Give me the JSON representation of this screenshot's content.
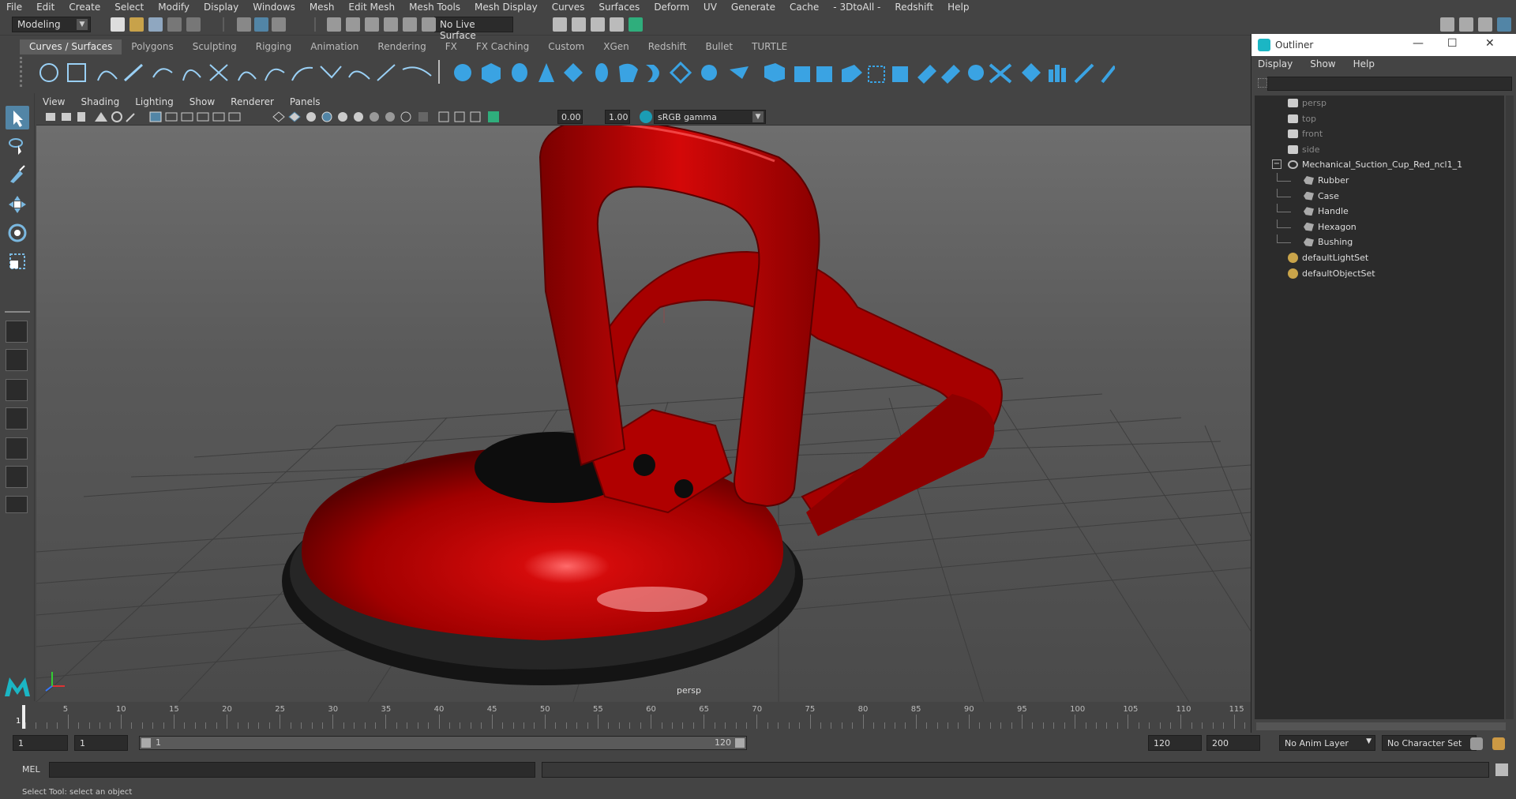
{
  "menubar": {
    "items": [
      "File",
      "Edit",
      "Create",
      "Select",
      "Modify",
      "Display",
      "Windows",
      "Mesh",
      "Edit Mesh",
      "Mesh Tools",
      "Mesh Display",
      "Curves",
      "Surfaces",
      "Deform",
      "UV",
      "Generate",
      "Cache",
      "- 3DtoAll -",
      "Redshift",
      "Help"
    ]
  },
  "statusline": {
    "mode": "Modeling",
    "live_surface": "No Live Surface"
  },
  "shelf": {
    "tabs": [
      "Curves / Surfaces",
      "Polygons",
      "Sculpting",
      "Rigging",
      "Animation",
      "Rendering",
      "FX",
      "FX Caching",
      "Custom",
      "XGen",
      "Redshift",
      "Bullet",
      "TURTLE"
    ],
    "active_tab": "Curves / Surfaces"
  },
  "viewport": {
    "menu": [
      "View",
      "Shading",
      "Lighting",
      "Show",
      "Renderer",
      "Panels"
    ],
    "exposure": "0.00",
    "gamma": "1.00",
    "color_space": "sRGB gamma",
    "camera_label": "persp"
  },
  "outliner": {
    "title": "Outliner",
    "menu": [
      "Display",
      "Show",
      "Help"
    ],
    "cameras": [
      "persp",
      "top",
      "front",
      "side"
    ],
    "root": "Mechanical_Suction_Cup_Red_ncl1_1",
    "children": [
      "Rubber",
      "Case",
      "Handle",
      "Hexagon",
      "Bushing"
    ],
    "sets": [
      "defaultLightSet",
      "defaultObjectSet"
    ]
  },
  "timeslider": {
    "current_frame_label": "1",
    "ticks": [
      "5",
      "10",
      "15",
      "20",
      "25",
      "30",
      "35",
      "40",
      "45",
      "50",
      "55",
      "60",
      "65",
      "70",
      "75",
      "80",
      "85",
      "90",
      "95",
      "100",
      "105",
      "110",
      "115"
    ]
  },
  "rangebar": {
    "start": "1",
    "playback_start": "1",
    "range_start_label": "1",
    "range_end_label": "120",
    "playback_end": "120",
    "end": "200",
    "anim_layer": "No Anim Layer",
    "character_set": "No Character Set"
  },
  "cmdline": {
    "label": "MEL"
  },
  "helpline": {
    "text": "Select Tool: select an object"
  },
  "colors": {
    "accent": "#5285a6",
    "model_red": "#b00000",
    "rubber": "#1a1a1a"
  }
}
